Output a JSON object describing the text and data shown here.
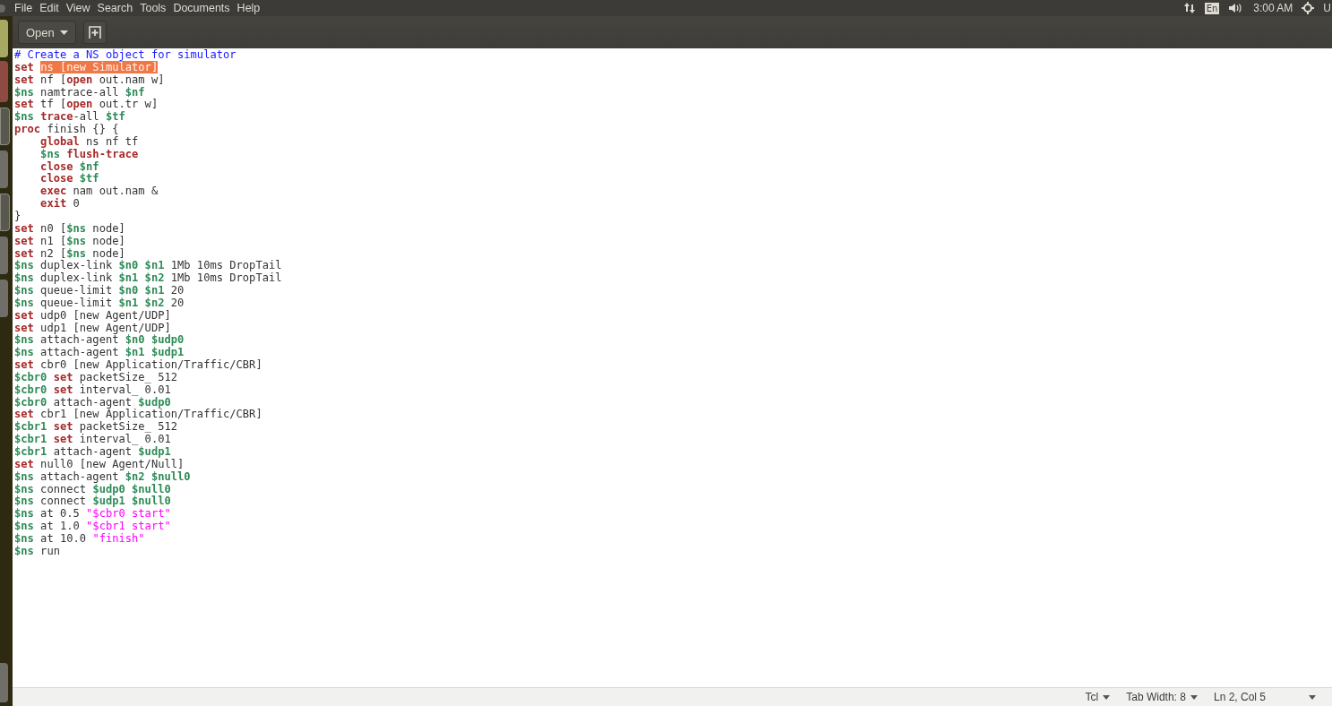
{
  "menu": [
    "File",
    "Edit",
    "View",
    "Search",
    "Tools",
    "Documents",
    "Help"
  ],
  "indicators": {
    "keyboard": "En",
    "clock": "3:00 AM",
    "user": "U"
  },
  "toolbar": {
    "open_button": "Open"
  },
  "lines": [
    [
      {
        "kind": "comment",
        "text": "# Create a NS object for simulator"
      }
    ],
    [
      {
        "kind": "keyword",
        "text": "set "
      },
      {
        "kind": "selection",
        "text": "ns [new Simulator]"
      }
    ],
    [
      {
        "kind": "keyword",
        "text": "set"
      },
      {
        "kind": "plain",
        "text": " nf ["
      },
      {
        "kind": "keyword",
        "text": "open"
      },
      {
        "kind": "plain",
        "text": " out.nam w]"
      }
    ],
    [
      {
        "kind": "variable",
        "text": "$ns"
      },
      {
        "kind": "plain",
        "text": " namtrace-all "
      },
      {
        "kind": "variable",
        "text": "$nf"
      }
    ],
    [
      {
        "kind": "keyword",
        "text": "set"
      },
      {
        "kind": "plain",
        "text": " tf ["
      },
      {
        "kind": "keyword",
        "text": "open"
      },
      {
        "kind": "plain",
        "text": " out.tr w]"
      }
    ],
    [
      {
        "kind": "variable",
        "text": "$ns "
      },
      {
        "kind": "keyword",
        "text": "trace"
      },
      {
        "kind": "plain",
        "text": "-all "
      },
      {
        "kind": "variable",
        "text": "$tf"
      }
    ],
    [
      {
        "kind": "keyword",
        "text": "proc"
      },
      {
        "kind": "plain",
        "text": " finish {} {"
      }
    ],
    [
      {
        "kind": "keyword",
        "text": "    global"
      },
      {
        "kind": "plain",
        "text": " ns nf tf"
      }
    ],
    [
      {
        "kind": "variable",
        "text": "    $ns "
      },
      {
        "kind": "keyword",
        "text": "flush-trace"
      }
    ],
    [
      {
        "kind": "keyword",
        "text": "    close "
      },
      {
        "kind": "variable",
        "text": "$nf"
      }
    ],
    [
      {
        "kind": "keyword",
        "text": "    close "
      },
      {
        "kind": "variable",
        "text": "$tf"
      }
    ],
    [
      {
        "kind": "keyword",
        "text": "    exec"
      },
      {
        "kind": "plain",
        "text": " nam out.nam &"
      }
    ],
    [
      {
        "kind": "keyword",
        "text": "    exit"
      },
      {
        "kind": "plain",
        "text": " 0"
      }
    ],
    [
      {
        "kind": "plain",
        "text": "}"
      }
    ],
    [
      {
        "kind": "keyword",
        "text": "set"
      },
      {
        "kind": "plain",
        "text": " n0 ["
      },
      {
        "kind": "variable",
        "text": "$ns"
      },
      {
        "kind": "plain",
        "text": " node]"
      }
    ],
    [
      {
        "kind": "keyword",
        "text": "set"
      },
      {
        "kind": "plain",
        "text": " n1 ["
      },
      {
        "kind": "variable",
        "text": "$ns"
      },
      {
        "kind": "plain",
        "text": " node]"
      }
    ],
    [
      {
        "kind": "keyword",
        "text": "set"
      },
      {
        "kind": "plain",
        "text": " n2 ["
      },
      {
        "kind": "variable",
        "text": "$ns"
      },
      {
        "kind": "plain",
        "text": " node]"
      }
    ],
    [
      {
        "kind": "variable",
        "text": "$ns"
      },
      {
        "kind": "plain",
        "text": " duplex-link "
      },
      {
        "kind": "variable",
        "text": "$n0 $n1"
      },
      {
        "kind": "plain",
        "text": " 1Mb 10ms DropTail"
      }
    ],
    [
      {
        "kind": "variable",
        "text": "$ns"
      },
      {
        "kind": "plain",
        "text": " duplex-link "
      },
      {
        "kind": "variable",
        "text": "$n1 $n2"
      },
      {
        "kind": "plain",
        "text": " 1Mb 10ms DropTail"
      }
    ],
    [
      {
        "kind": "variable",
        "text": "$ns"
      },
      {
        "kind": "plain",
        "text": " queue-limit "
      },
      {
        "kind": "variable",
        "text": "$n0 $n1"
      },
      {
        "kind": "plain",
        "text": " 20"
      }
    ],
    [
      {
        "kind": "variable",
        "text": "$ns"
      },
      {
        "kind": "plain",
        "text": " queue-limit "
      },
      {
        "kind": "variable",
        "text": "$n1 $n2"
      },
      {
        "kind": "plain",
        "text": " 20"
      }
    ],
    [
      {
        "kind": "keyword",
        "text": "set"
      },
      {
        "kind": "plain",
        "text": " udp0 [new Agent/UDP]"
      }
    ],
    [
      {
        "kind": "keyword",
        "text": "set"
      },
      {
        "kind": "plain",
        "text": " udp1 [new Agent/UDP]"
      }
    ],
    [
      {
        "kind": "variable",
        "text": "$ns"
      },
      {
        "kind": "plain",
        "text": " attach-agent "
      },
      {
        "kind": "variable",
        "text": "$n0 $udp0"
      }
    ],
    [
      {
        "kind": "variable",
        "text": "$ns"
      },
      {
        "kind": "plain",
        "text": " attach-agent "
      },
      {
        "kind": "variable",
        "text": "$n1 $udp1"
      }
    ],
    [
      {
        "kind": "keyword",
        "text": "set"
      },
      {
        "kind": "plain",
        "text": " cbr0 [new Application/Traffic/CBR]"
      }
    ],
    [
      {
        "kind": "variable",
        "text": "$cbr0 "
      },
      {
        "kind": "keyword",
        "text": "set"
      },
      {
        "kind": "plain",
        "text": " packetSize_ 512"
      }
    ],
    [
      {
        "kind": "variable",
        "text": "$cbr0 "
      },
      {
        "kind": "keyword",
        "text": "set"
      },
      {
        "kind": "plain",
        "text": " interval_ 0.01"
      }
    ],
    [
      {
        "kind": "variable",
        "text": "$cbr0"
      },
      {
        "kind": "plain",
        "text": " attach-agent "
      },
      {
        "kind": "variable",
        "text": "$udp0"
      }
    ],
    [
      {
        "kind": "keyword",
        "text": "set"
      },
      {
        "kind": "plain",
        "text": " cbr1 [new Application/Traffic/CBR]"
      }
    ],
    [
      {
        "kind": "variable",
        "text": "$cbr1 "
      },
      {
        "kind": "keyword",
        "text": "set"
      },
      {
        "kind": "plain",
        "text": " packetSize_ 512"
      }
    ],
    [
      {
        "kind": "variable",
        "text": "$cbr1 "
      },
      {
        "kind": "keyword",
        "text": "set"
      },
      {
        "kind": "plain",
        "text": " interval_ 0.01"
      }
    ],
    [
      {
        "kind": "variable",
        "text": "$cbr1"
      },
      {
        "kind": "plain",
        "text": " attach-agent "
      },
      {
        "kind": "variable",
        "text": "$udp1"
      }
    ],
    [
      {
        "kind": "keyword",
        "text": "set"
      },
      {
        "kind": "plain",
        "text": " null0 [new Agent/Null]"
      }
    ],
    [
      {
        "kind": "variable",
        "text": "$ns"
      },
      {
        "kind": "plain",
        "text": " attach-agent "
      },
      {
        "kind": "variable",
        "text": "$n2 $null0"
      }
    ],
    [
      {
        "kind": "variable",
        "text": "$ns"
      },
      {
        "kind": "plain",
        "text": " connect "
      },
      {
        "kind": "variable",
        "text": "$udp0 $null0"
      }
    ],
    [
      {
        "kind": "variable",
        "text": "$ns"
      },
      {
        "kind": "plain",
        "text": " connect "
      },
      {
        "kind": "variable",
        "text": "$udp1 $null0"
      }
    ],
    [
      {
        "kind": "variable",
        "text": "$ns"
      },
      {
        "kind": "plain",
        "text": " at 0.5 "
      },
      {
        "kind": "string",
        "text": "\"$cbr0 start\""
      }
    ],
    [
      {
        "kind": "variable",
        "text": "$ns"
      },
      {
        "kind": "plain",
        "text": " at 1.0 "
      },
      {
        "kind": "string",
        "text": "\"$cbr1 start\""
      }
    ],
    [
      {
        "kind": "variable",
        "text": "$ns"
      },
      {
        "kind": "plain",
        "text": " at 10.0 "
      },
      {
        "kind": "string",
        "text": "\"finish\""
      }
    ],
    [
      {
        "kind": "variable",
        "text": "$ns"
      },
      {
        "kind": "plain",
        "text": " run"
      }
    ]
  ],
  "status_bar": {
    "language": "Tcl",
    "tab_width": "Tab Width: 8",
    "position": "Ln 2, Col 5"
  }
}
